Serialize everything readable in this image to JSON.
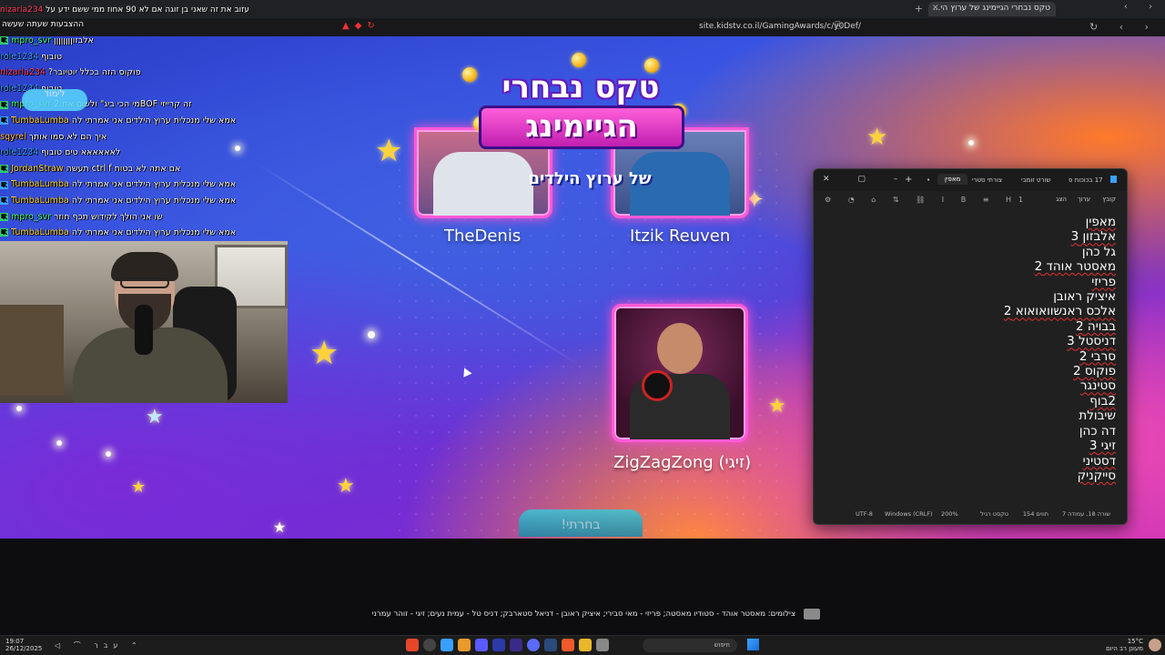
{
  "browser": {
    "tab_title": "טקס נבחרי הגיימינג של ערוץ הי...",
    "url": "site.kidstv.co.il/GamingAwards/c/y0Def/"
  },
  "stream_top": {
    "line1_user": "nizaria234",
    "line1_msg": "עזוב את זה שאני בן זוגה אם לא 90 אחוז ממי ששם ידע על",
    "line2_msg": "ההצבעות שעתה שעשה"
  },
  "chat": [
    {
      "badge": "green",
      "user": "mpro_svr",
      "color": "#3cff7a",
      "msg": "אלבזוןןןןןןןן"
    },
    {
      "badge": "",
      "user": "role1234",
      "color": "#3aa0ff",
      "msg": "טובוף"
    },
    {
      "badge": "",
      "user": "nizaria234",
      "color": "#ff3a5a",
      "msg": "פוקוס הזה בכלל יוטיובר?"
    },
    {
      "badge": "",
      "user": "role1234",
      "color": "#3aa0ff",
      "msg": "טובוף"
    },
    {
      "badge": "green",
      "user": "mpro_svr",
      "color": "#3cff7a",
      "msg": "זה קרייזי BOFמי הכי ביג\" ולשים את 2"
    },
    {
      "badge": "blue",
      "user": "TumbaLumba",
      "color": "#ffd84a",
      "msg": "אמא שלי מנכלית ערוץ הילדים אני אמרתי לה"
    },
    {
      "badge": "",
      "user": "sqyrel",
      "color": "#ffb84a",
      "msg": "איך הם לא סמו אותך"
    },
    {
      "badge": "",
      "user": "role1234",
      "color": "#3aa0ff",
      "msg": "לאאאאאא טים טובוף"
    },
    {
      "badge": "green",
      "user": "JordanStraw",
      "color": "#ffd84a",
      "msg": "אם אתה לא בטוח ctrl f תעשה"
    },
    {
      "badge": "blue",
      "user": "TumbaLumba",
      "color": "#ffd84a",
      "msg": "אמא שלי מנכלית ערוץ הילדים אני אמרתי לה"
    },
    {
      "badge": "blue",
      "user": "TumbaLumba",
      "color": "#ffd84a",
      "msg": "אמא שלי מנכלית ערוץ הילדים אני אמרתי לה"
    },
    {
      "badge": "green",
      "user": "mpro_svr",
      "color": "#3cff7a",
      "msg": "שו אני הולך לקידוש תכף חוזר"
    },
    {
      "badge": "green",
      "user": "TumbaLumba",
      "color": "#ffd84a",
      "msg": "אמא שלי מנכלית ערוץ הילדים אני אמרתי לה"
    }
  ],
  "chat_bubble": "לימוד",
  "game": {
    "logo_title": "טקס נבחרי",
    "logo_gaming": "הגיימינג",
    "logo_sub": "של ערוץ הילדים",
    "nominees": [
      {
        "name": "TheDenis"
      },
      {
        "name": "Itzik Reuven"
      },
      {
        "name": "ZigZagZong (זיגי)"
      }
    ],
    "confirm_label": "בחרתי!"
  },
  "notepad": {
    "tabs": [
      "17 בכוכות פ",
      "שורט זומבי",
      "צורתי סטרי",
      "מאפין"
    ],
    "menu": [
      "קובץ",
      "ערוך",
      "הצג"
    ],
    "lines": [
      {
        "text": "מאפין",
        "misspelled": true
      },
      {
        "text": "אלבזון 3",
        "misspelled": true
      },
      {
        "text": "גל כהן",
        "misspelled": false
      },
      {
        "text": "מאסטר אוהד 2",
        "misspelled": true
      },
      {
        "text": "פריזי",
        "misspelled": true
      },
      {
        "text": "איציק ראובן",
        "misspelled": false
      },
      {
        "text": "אלכס ראנשוואואוא 2",
        "misspelled": true
      },
      {
        "text": "בבויה 2",
        "misspelled": true
      },
      {
        "text": "דניסטל 3",
        "misspelled": true
      },
      {
        "text": "סרבי 2",
        "misspelled": true
      },
      {
        "text": "פוקוס 2",
        "misspelled": true
      },
      {
        "text": "סטינגר",
        "misspelled": true
      },
      {
        "text": "2בוף",
        "misspelled": true
      },
      {
        "text": "שיבולת",
        "misspelled": false
      },
      {
        "text": "דה כהן",
        "misspelled": false
      },
      {
        "text": "זיגי 3",
        "misspelled": true
      },
      {
        "text": "דסטיני",
        "misspelled": true
      },
      {
        "text": "סייקניק",
        "misspelled": true
      }
    ],
    "status": {
      "position": "שורה 18, עמודה 7",
      "chars": "154 תווים",
      "format": "טקסט רגיל",
      "zoom": "200%",
      "line_ending": "Windows (CRLF)",
      "encoding": "UTF-8"
    }
  },
  "caption": "צילומים: מאסטר אוהד - סטודיו מאסטה; פריזי - מאי סבירי; איציק ראובן - דניאל סטארבק; דניס טל - עמית נעים; זיגי - זוהר עמרני",
  "taskbar": {
    "time": "19:07",
    "date": "26/12/2025",
    "lang": "עבר",
    "search": "חיפוש",
    "temp": "15°C",
    "weather": "מעונן רב היום"
  }
}
